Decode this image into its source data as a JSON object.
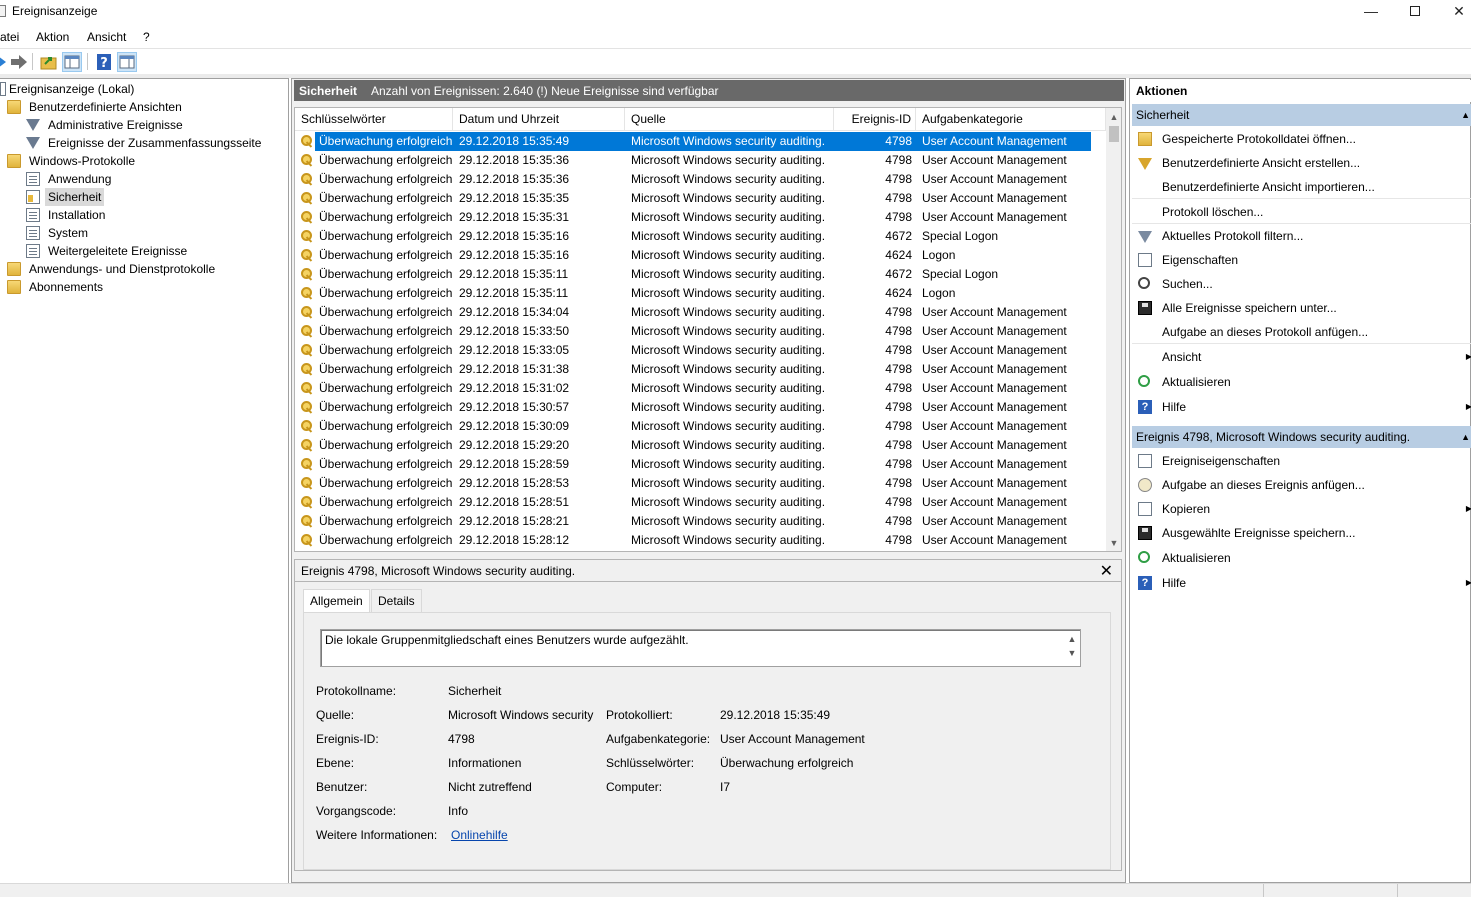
{
  "window": {
    "title": "Ereignisanzeige",
    "min": "—",
    "close": "✕"
  },
  "menu": [
    "atei",
    "Aktion",
    "Ansicht",
    "?"
  ],
  "tree": {
    "root": "Ereignisanzeige (Lokal)",
    "custom_views": "Benutzerdefinierte Ansichten",
    "admin_events": "Administrative Ereignisse",
    "summary_events": "Ereignisse der Zusammenfassungsseite",
    "windows_logs": "Windows-Protokolle",
    "application": "Anwendung",
    "security": "Sicherheit",
    "setup": "Installation",
    "system": "System",
    "forwarded": "Weitergeleitete Ereignisse",
    "app_service_logs": "Anwendungs- und Dienstprotokolle",
    "subscriptions": "Abonnements"
  },
  "log_header": {
    "name": "Sicherheit",
    "count": "Anzahl von Ereignissen: 2.640 (!) Neue Ereignisse sind verfügbar"
  },
  "columns": {
    "keywords": "Schlüsselwörter",
    "datetime": "Datum und Uhrzeit",
    "source": "Quelle",
    "event_id": "Ereignis-ID",
    "category": "Aufgabenkategorie"
  },
  "events": [
    {
      "keywords": "Überwachung erfolgreich",
      "datetime": "29.12.2018 15:35:49",
      "source": "Microsoft Windows security auditing.",
      "id": "4798",
      "category": "User Account Management"
    },
    {
      "keywords": "Überwachung erfolgreich",
      "datetime": "29.12.2018 15:35:36",
      "source": "Microsoft Windows security auditing.",
      "id": "4798",
      "category": "User Account Management"
    },
    {
      "keywords": "Überwachung erfolgreich",
      "datetime": "29.12.2018 15:35:36",
      "source": "Microsoft Windows security auditing.",
      "id": "4798",
      "category": "User Account Management"
    },
    {
      "keywords": "Überwachung erfolgreich",
      "datetime": "29.12.2018 15:35:35",
      "source": "Microsoft Windows security auditing.",
      "id": "4798",
      "category": "User Account Management"
    },
    {
      "keywords": "Überwachung erfolgreich",
      "datetime": "29.12.2018 15:35:31",
      "source": "Microsoft Windows security auditing.",
      "id": "4798",
      "category": "User Account Management"
    },
    {
      "keywords": "Überwachung erfolgreich",
      "datetime": "29.12.2018 15:35:16",
      "source": "Microsoft Windows security auditing.",
      "id": "4672",
      "category": "Special Logon"
    },
    {
      "keywords": "Überwachung erfolgreich",
      "datetime": "29.12.2018 15:35:16",
      "source": "Microsoft Windows security auditing.",
      "id": "4624",
      "category": "Logon"
    },
    {
      "keywords": "Überwachung erfolgreich",
      "datetime": "29.12.2018 15:35:11",
      "source": "Microsoft Windows security auditing.",
      "id": "4672",
      "category": "Special Logon"
    },
    {
      "keywords": "Überwachung erfolgreich",
      "datetime": "29.12.2018 15:35:11",
      "source": "Microsoft Windows security auditing.",
      "id": "4624",
      "category": "Logon"
    },
    {
      "keywords": "Überwachung erfolgreich",
      "datetime": "29.12.2018 15:34:04",
      "source": "Microsoft Windows security auditing.",
      "id": "4798",
      "category": "User Account Management"
    },
    {
      "keywords": "Überwachung erfolgreich",
      "datetime": "29.12.2018 15:33:50",
      "source": "Microsoft Windows security auditing.",
      "id": "4798",
      "category": "User Account Management"
    },
    {
      "keywords": "Überwachung erfolgreich",
      "datetime": "29.12.2018 15:33:05",
      "source": "Microsoft Windows security auditing.",
      "id": "4798",
      "category": "User Account Management"
    },
    {
      "keywords": "Überwachung erfolgreich",
      "datetime": "29.12.2018 15:31:38",
      "source": "Microsoft Windows security auditing.",
      "id": "4798",
      "category": "User Account Management"
    },
    {
      "keywords": "Überwachung erfolgreich",
      "datetime": "29.12.2018 15:31:02",
      "source": "Microsoft Windows security auditing.",
      "id": "4798",
      "category": "User Account Management"
    },
    {
      "keywords": "Überwachung erfolgreich",
      "datetime": "29.12.2018 15:30:57",
      "source": "Microsoft Windows security auditing.",
      "id": "4798",
      "category": "User Account Management"
    },
    {
      "keywords": "Überwachung erfolgreich",
      "datetime": "29.12.2018 15:30:09",
      "source": "Microsoft Windows security auditing.",
      "id": "4798",
      "category": "User Account Management"
    },
    {
      "keywords": "Überwachung erfolgreich",
      "datetime": "29.12.2018 15:29:20",
      "source": "Microsoft Windows security auditing.",
      "id": "4798",
      "category": "User Account Management"
    },
    {
      "keywords": "Überwachung erfolgreich",
      "datetime": "29.12.2018 15:28:59",
      "source": "Microsoft Windows security auditing.",
      "id": "4798",
      "category": "User Account Management"
    },
    {
      "keywords": "Überwachung erfolgreich",
      "datetime": "29.12.2018 15:28:53",
      "source": "Microsoft Windows security auditing.",
      "id": "4798",
      "category": "User Account Management"
    },
    {
      "keywords": "Überwachung erfolgreich",
      "datetime": "29.12.2018 15:28:51",
      "source": "Microsoft Windows security auditing.",
      "id": "4798",
      "category": "User Account Management"
    },
    {
      "keywords": "Überwachung erfolgreich",
      "datetime": "29.12.2018 15:28:21",
      "source": "Microsoft Windows security auditing.",
      "id": "4798",
      "category": "User Account Management"
    },
    {
      "keywords": "Überwachung erfolgreich",
      "datetime": "29.12.2018 15:28:12",
      "source": "Microsoft Windows security auditing.",
      "id": "4798",
      "category": "User Account Management"
    }
  ],
  "detail": {
    "title": "Ereignis 4798, Microsoft Windows security auditing.",
    "close": "✕",
    "tab_general": "Allgemein",
    "tab_details": "Details",
    "description": "Die lokale Gruppenmitgliedschaft eines Benutzers wurde aufgezählt.",
    "labels": {
      "log_name": "Protokollname:",
      "source": "Quelle:",
      "event_id": "Ereignis-ID:",
      "level": "Ebene:",
      "user": "Benutzer:",
      "opcode": "Vorgangscode:",
      "more_info": "Weitere Informationen:",
      "logged": "Protokolliert:",
      "task_category": "Aufgabenkategorie:",
      "keywords": "Schlüsselwörter:",
      "computer": "Computer:"
    },
    "values": {
      "log_name": "Sicherheit",
      "source": "Microsoft Windows security",
      "event_id": "4798",
      "level": "Informationen",
      "user": "Nicht zutreffend",
      "opcode": "Info",
      "more_info": "Onlinehilfe",
      "logged": "29.12.2018 15:35:49",
      "task_category": "User Account Management",
      "keywords": "Überwachung erfolgreich",
      "computer": "I7"
    }
  },
  "actions": {
    "title": "Aktionen",
    "section_log": "Sicherheit",
    "log_items": [
      "Gespeicherte Protokolldatei öffnen...",
      "Benutzerdefinierte Ansicht erstellen...",
      "Benutzerdefinierte Ansicht importieren...",
      "Protokoll löschen...",
      "Aktuelles Protokoll filtern...",
      "Eigenschaften",
      "Suchen...",
      "Alle Ereignisse speichern unter...",
      "Aufgabe an dieses Protokoll anfügen...",
      "Ansicht",
      "Aktualisieren",
      "Hilfe"
    ],
    "section_event": "Ereignis 4798, Microsoft Windows security auditing.",
    "event_items": [
      "Ereigniseigenschaften",
      "Aufgabe an dieses Ereignis anfügen...",
      "Kopieren",
      "Ausgewählte Ereignisse speichern...",
      "Aktualisieren",
      "Hilfe"
    ]
  }
}
